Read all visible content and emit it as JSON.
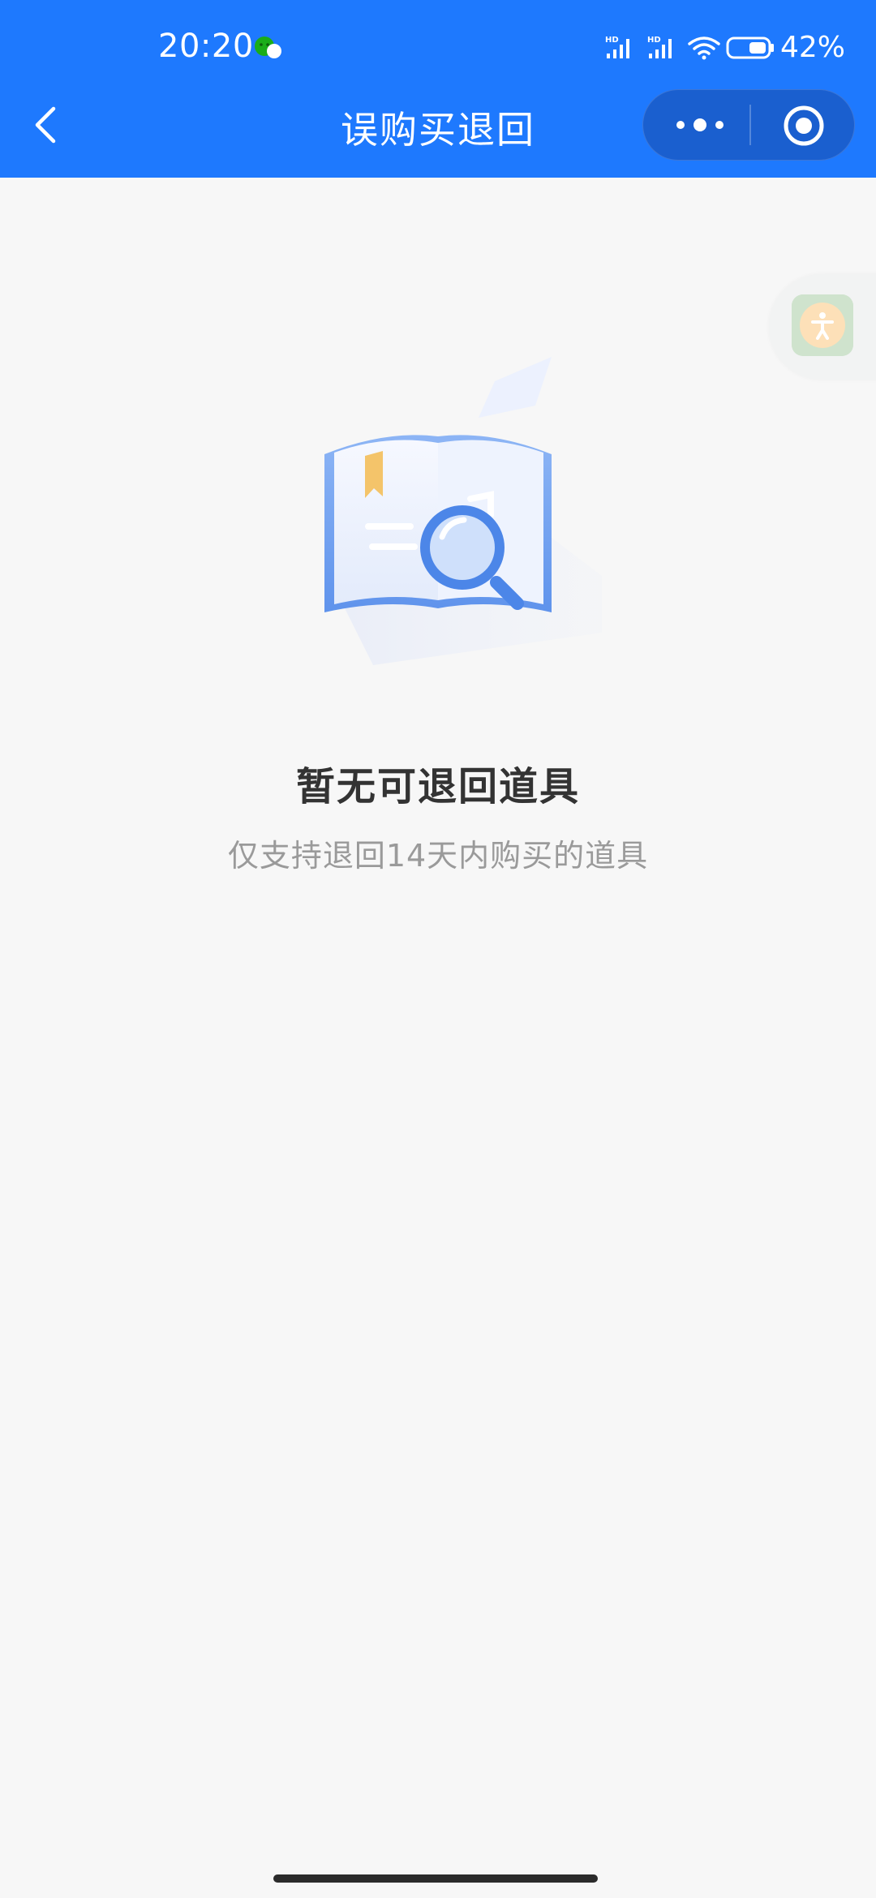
{
  "status_bar": {
    "time": "20:20",
    "battery_percent": "42%",
    "signal_label": "HD"
  },
  "nav": {
    "title": "误购买退回",
    "back_icon": "chevron-left-icon",
    "more_icon": "more-dots-icon",
    "close_icon": "target-circle-icon"
  },
  "empty_state": {
    "title": "暂无可退回道具",
    "subtitle": "仅支持退回14天内购买的道具",
    "illustration": "book-magnifier-illustration"
  },
  "float_widget": {
    "icon": "accessibility-icon"
  },
  "colors": {
    "header": "#1e79fe",
    "capsule": "#1a5fcf",
    "background": "#f7f7f7",
    "title_text": "#333333",
    "subtitle_text": "#9a9a9a"
  }
}
